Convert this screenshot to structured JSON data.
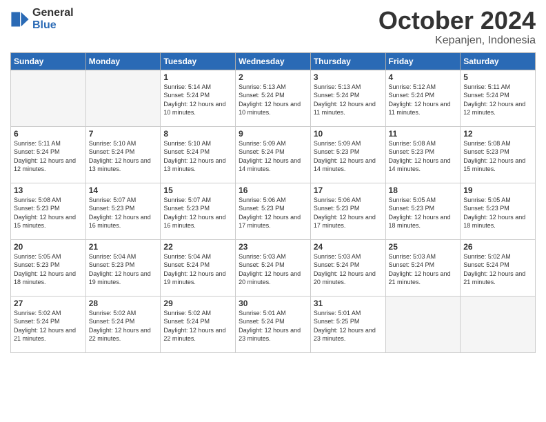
{
  "logo": {
    "general": "General",
    "blue": "Blue",
    "icon": "▶"
  },
  "header": {
    "month": "October 2024",
    "location": "Kepanjen, Indonesia"
  },
  "weekdays": [
    "Sunday",
    "Monday",
    "Tuesday",
    "Wednesday",
    "Thursday",
    "Friday",
    "Saturday"
  ],
  "weeks": [
    [
      {
        "day": "",
        "empty": true
      },
      {
        "day": "",
        "empty": true
      },
      {
        "day": "1",
        "sunrise": "5:14 AM",
        "sunset": "5:24 PM",
        "daylight": "12 hours and 10 minutes."
      },
      {
        "day": "2",
        "sunrise": "5:13 AM",
        "sunset": "5:24 PM",
        "daylight": "12 hours and 10 minutes."
      },
      {
        "day": "3",
        "sunrise": "5:13 AM",
        "sunset": "5:24 PM",
        "daylight": "12 hours and 11 minutes."
      },
      {
        "day": "4",
        "sunrise": "5:12 AM",
        "sunset": "5:24 PM",
        "daylight": "12 hours and 11 minutes."
      },
      {
        "day": "5",
        "sunrise": "5:11 AM",
        "sunset": "5:24 PM",
        "daylight": "12 hours and 12 minutes."
      }
    ],
    [
      {
        "day": "6",
        "sunrise": "5:11 AM",
        "sunset": "5:24 PM",
        "daylight": "12 hours and 12 minutes."
      },
      {
        "day": "7",
        "sunrise": "5:10 AM",
        "sunset": "5:24 PM",
        "daylight": "12 hours and 13 minutes."
      },
      {
        "day": "8",
        "sunrise": "5:10 AM",
        "sunset": "5:24 PM",
        "daylight": "12 hours and 13 minutes."
      },
      {
        "day": "9",
        "sunrise": "5:09 AM",
        "sunset": "5:24 PM",
        "daylight": "12 hours and 14 minutes."
      },
      {
        "day": "10",
        "sunrise": "5:09 AM",
        "sunset": "5:23 PM",
        "daylight": "12 hours and 14 minutes."
      },
      {
        "day": "11",
        "sunrise": "5:08 AM",
        "sunset": "5:23 PM",
        "daylight": "12 hours and 14 minutes."
      },
      {
        "day": "12",
        "sunrise": "5:08 AM",
        "sunset": "5:23 PM",
        "daylight": "12 hours and 15 minutes."
      }
    ],
    [
      {
        "day": "13",
        "sunrise": "5:08 AM",
        "sunset": "5:23 PM",
        "daylight": "12 hours and 15 minutes."
      },
      {
        "day": "14",
        "sunrise": "5:07 AM",
        "sunset": "5:23 PM",
        "daylight": "12 hours and 16 minutes."
      },
      {
        "day": "15",
        "sunrise": "5:07 AM",
        "sunset": "5:23 PM",
        "daylight": "12 hours and 16 minutes."
      },
      {
        "day": "16",
        "sunrise": "5:06 AM",
        "sunset": "5:23 PM",
        "daylight": "12 hours and 17 minutes."
      },
      {
        "day": "17",
        "sunrise": "5:06 AM",
        "sunset": "5:23 PM",
        "daylight": "12 hours and 17 minutes."
      },
      {
        "day": "18",
        "sunrise": "5:05 AM",
        "sunset": "5:23 PM",
        "daylight": "12 hours and 18 minutes."
      },
      {
        "day": "19",
        "sunrise": "5:05 AM",
        "sunset": "5:23 PM",
        "daylight": "12 hours and 18 minutes."
      }
    ],
    [
      {
        "day": "20",
        "sunrise": "5:05 AM",
        "sunset": "5:23 PM",
        "daylight": "12 hours and 18 minutes."
      },
      {
        "day": "21",
        "sunrise": "5:04 AM",
        "sunset": "5:23 PM",
        "daylight": "12 hours and 19 minutes."
      },
      {
        "day": "22",
        "sunrise": "5:04 AM",
        "sunset": "5:24 PM",
        "daylight": "12 hours and 19 minutes."
      },
      {
        "day": "23",
        "sunrise": "5:03 AM",
        "sunset": "5:24 PM",
        "daylight": "12 hours and 20 minutes."
      },
      {
        "day": "24",
        "sunrise": "5:03 AM",
        "sunset": "5:24 PM",
        "daylight": "12 hours and 20 minutes."
      },
      {
        "day": "25",
        "sunrise": "5:03 AM",
        "sunset": "5:24 PM",
        "daylight": "12 hours and 21 minutes."
      },
      {
        "day": "26",
        "sunrise": "5:02 AM",
        "sunset": "5:24 PM",
        "daylight": "12 hours and 21 minutes."
      }
    ],
    [
      {
        "day": "27",
        "sunrise": "5:02 AM",
        "sunset": "5:24 PM",
        "daylight": "12 hours and 21 minutes."
      },
      {
        "day": "28",
        "sunrise": "5:02 AM",
        "sunset": "5:24 PM",
        "daylight": "12 hours and 22 minutes."
      },
      {
        "day": "29",
        "sunrise": "5:02 AM",
        "sunset": "5:24 PM",
        "daylight": "12 hours and 22 minutes."
      },
      {
        "day": "30",
        "sunrise": "5:01 AM",
        "sunset": "5:24 PM",
        "daylight": "12 hours and 23 minutes."
      },
      {
        "day": "31",
        "sunrise": "5:01 AM",
        "sunset": "5:25 PM",
        "daylight": "12 hours and 23 minutes."
      },
      {
        "day": "",
        "empty": true
      },
      {
        "day": "",
        "empty": true
      }
    ]
  ]
}
